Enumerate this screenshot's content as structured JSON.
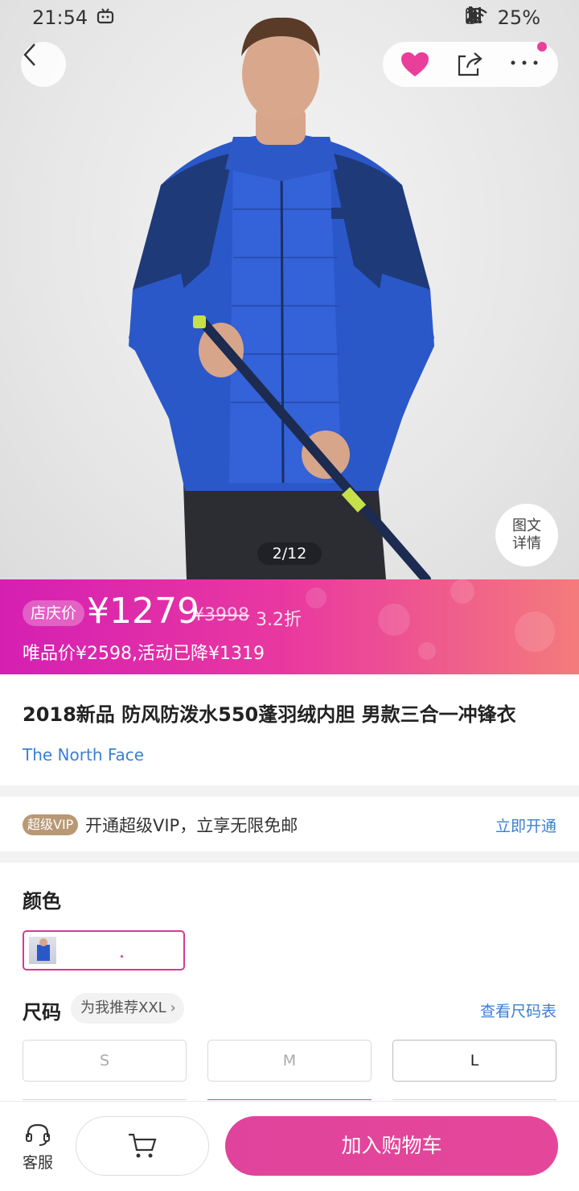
{
  "status_bar": {
    "time": "21:54",
    "battery": "25%"
  },
  "hero": {
    "pager": "2/12",
    "detail_label_line1": "图文",
    "detail_label_line2": "详情"
  },
  "price": {
    "tag": "店庆价",
    "current": "¥1279",
    "original": "¥3998",
    "discount": "3.2折",
    "subline": "唯品价¥2598,活动已降¥1319"
  },
  "product": {
    "title": "2018新品 防风防泼水550蓬羽绒内胆 男款三合一冲锋衣",
    "brand": "The North Face"
  },
  "vip": {
    "badge": "超级VIP",
    "text": "开通超级VIP，立享无限免邮",
    "link": "立即开通"
  },
  "options": {
    "color_label": "颜色",
    "size_label": "尺码",
    "recommend": "为我推荐XXL",
    "size_chart": "查看尺码表",
    "sizes": [
      "S",
      "M",
      "L"
    ],
    "selected_size": "L"
  },
  "bottom": {
    "service": "客服",
    "add_to_cart": "加入购物车"
  },
  "colors": {
    "accent": "#e0439b",
    "link": "#3a7fd5",
    "jacket": "#2a58c9"
  }
}
